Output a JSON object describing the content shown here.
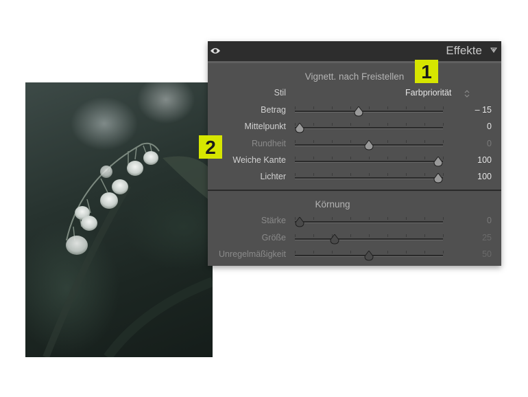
{
  "panel": {
    "title": "Effekte",
    "icons": {
      "visibility": "eye-icon",
      "collapse": "triangle-icon"
    },
    "vignette": {
      "title": "Vignett. nach Freistellen",
      "style_label": "Stil",
      "style_value": "Farbpriorität",
      "sliders": [
        {
          "label": "Betrag",
          "value": "– 15",
          "level": 0.425,
          "dim": false
        },
        {
          "label": "Mittelpunkt",
          "value": "0",
          "level": 0.0,
          "dim": false
        },
        {
          "label": "Rundheit",
          "value": "0",
          "level": 0.5,
          "dim": true
        },
        {
          "label": "Weiche Kante",
          "value": "100",
          "level": 1.0,
          "dim": false
        },
        {
          "label": "Lichter",
          "value": "100",
          "level": 1.0,
          "dim": false
        }
      ]
    },
    "grain": {
      "title": "Körnung",
      "sliders": [
        {
          "label": "Stärke",
          "value": "0",
          "level": 0.0,
          "dim": true
        },
        {
          "label": "Größe",
          "value": "25",
          "level": 0.25,
          "dim": true
        },
        {
          "label": "Unregelmäßigkeit",
          "value": "50",
          "level": 0.5,
          "dim": true
        }
      ]
    }
  },
  "badges": {
    "one": "1",
    "two": "2"
  },
  "colors": {
    "badge": "#d6e600",
    "panel": "#505050",
    "header": "#2d2d2d"
  }
}
